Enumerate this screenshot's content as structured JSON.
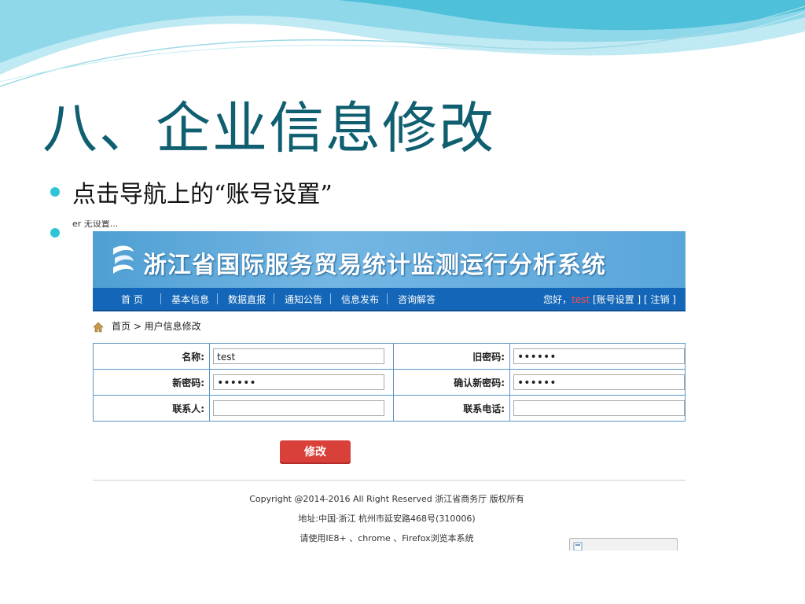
{
  "slide": {
    "title": "八、企业信息修改",
    "bullet1": "点击导航上的“账号设置”"
  },
  "screenshot": {
    "crop_text": "er 无设置...",
    "system_title": "浙江省国际服务贸易统计监测运行分析系统",
    "nav": [
      "首 页",
      "基本信息",
      "数据直报",
      "通知公告",
      "信息发布",
      "咨询解答"
    ],
    "nav_greeting": "您好，",
    "nav_user": "test",
    "nav_links": "[账号设置 ] [ 注销 ]",
    "breadcrumb": "首页 > 用户信息修改",
    "form": {
      "name_label": "名称:",
      "name_value": "test",
      "old_pw_label": "旧密码:",
      "old_pw_value": "••••••",
      "new_pw_label": "新密码:",
      "new_pw_value": "••••••",
      "confirm_pw_label": "确认新密码:",
      "confirm_pw_value": "••••••",
      "contact_label": "联系人:",
      "contact_value": "",
      "phone_label": "联系电话:",
      "phone_value": ""
    },
    "submit_label": "修改",
    "footer": {
      "copyright": "Copyright @2014-2016 All Right Reserved 浙江省商务厅 版权所有",
      "address": "地址:中国·浙江 杭州市延安路468号(310006)",
      "browser_note": "请使用IE8+ 、chrome 、Firefox浏览本系统"
    }
  },
  "colors": {
    "title": "#0f5f70",
    "nav_bg": "#1467b8",
    "submit": "#d9403a",
    "bullet": "#2ec4d6"
  }
}
